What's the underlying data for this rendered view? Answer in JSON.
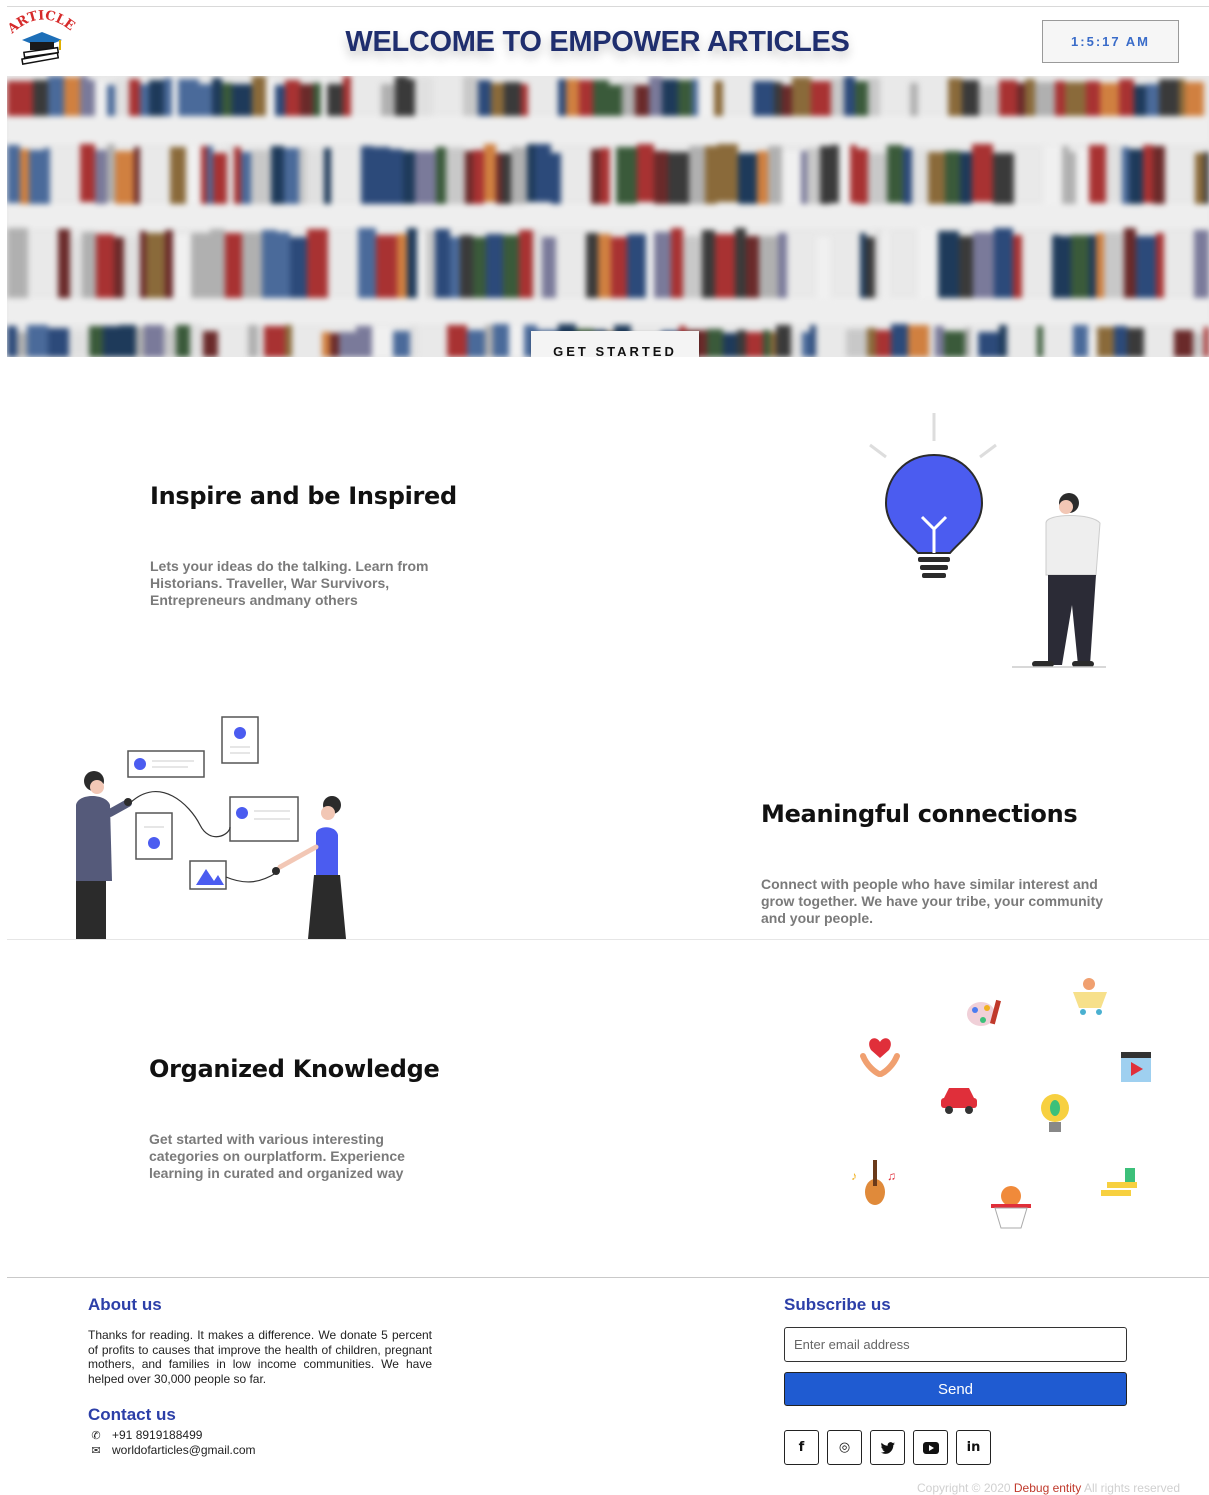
{
  "header": {
    "logo_text": "ARTICLE",
    "title": "WELCOME TO EMPOWER ARTICLES",
    "clock": "1:5:17 AM"
  },
  "hero": {
    "cta_label": "GET STARTED"
  },
  "features": [
    {
      "title": "Inspire and be Inspired",
      "text": "Lets your ideas do the talking. Learn from Historians. Traveller, War Survivors, Entrepreneurs andmany others"
    },
    {
      "title": "Meaningful connections",
      "text": "Connect with people who have similar interest and grow together. We have your tribe, your community and your people."
    },
    {
      "title": "Organized Knowledge",
      "text": "Get started with various interesting categories on ourplatform. Experience learning in curated and organized way"
    }
  ],
  "footer": {
    "about": {
      "heading": "About us",
      "text": "Thanks for reading. It makes a difference. We donate 5 percent of profits to causes that improve the health of children, pregnant mothers, and families in low income communities. We have helped over 30,000 people so far."
    },
    "contact": {
      "heading": "Contact us",
      "phone": "+91 8919188499",
      "email": "worldofarticles@gmail.com"
    },
    "subscribe": {
      "heading": "Subscribe us",
      "email_placeholder": "Enter email address",
      "send_label": "Send"
    },
    "socials": [
      {
        "icon": "facebook-icon",
        "glyph": "f"
      },
      {
        "icon": "instagram-icon",
        "glyph": "◎"
      },
      {
        "icon": "twitter-icon",
        "glyph": "🐦"
      },
      {
        "icon": "youtube-icon",
        "glyph": "▶"
      },
      {
        "icon": "linkedin-icon",
        "glyph": "in"
      }
    ],
    "copyright": {
      "prefix": "Copyright © 2020 ",
      "brand": "Debug entity",
      "suffix": " All rights reserved"
    }
  }
}
